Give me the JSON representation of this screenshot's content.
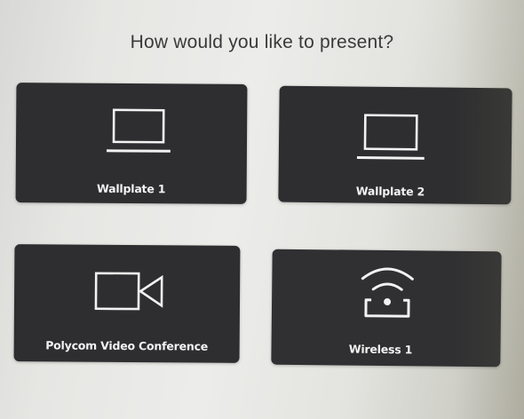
{
  "prompt": {
    "title": "How would you like to present?"
  },
  "options": [
    {
      "id": "wallplate-1",
      "label": "Wallplate 1",
      "icon": "laptop-icon"
    },
    {
      "id": "wallplate-2",
      "label": "Wallplate 2",
      "icon": "laptop-icon"
    },
    {
      "id": "polycom-video-conference",
      "label": "Polycom Video Conference",
      "icon": "video-camera-icon"
    },
    {
      "id": "wireless-1",
      "label": "Wireless 1",
      "icon": "wireless-cast-icon"
    }
  ],
  "colors": {
    "tile_background": "#2e2e30",
    "tile_foreground": "#f2f2f2",
    "page_background": "#e8e8e5",
    "title_text": "#3a3a3a"
  }
}
